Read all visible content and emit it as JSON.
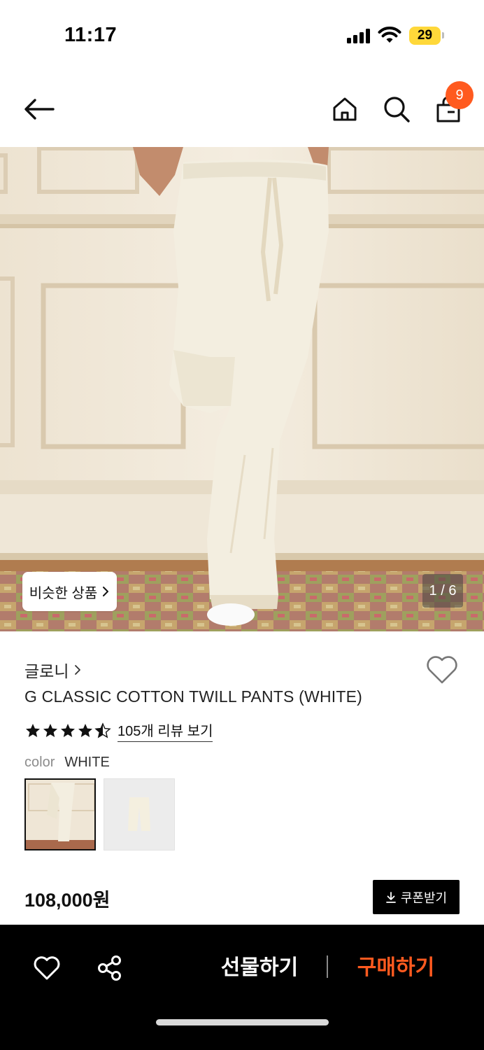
{
  "status_bar": {
    "time": "11:17",
    "battery": "29"
  },
  "nav": {
    "cart_count": "9"
  },
  "hero": {
    "similar_button": "비슷한 상품",
    "page_indicator": "1 / 6"
  },
  "product": {
    "brand": "글로니",
    "title": "G CLASSIC COTTON TWILL PANTS (WHITE)",
    "rating": 4.5,
    "review_link": "105개 리뷰 보기",
    "color_label": "color",
    "color_value": "WHITE",
    "price": "108,000원"
  },
  "coupon_button": "쿠폰받기",
  "bottom_bar": {
    "gift_label": "선물하기",
    "buy_label": "구매하기"
  },
  "colors": {
    "accent": "#ff5a1f",
    "battery": "#ffd83a",
    "bar": "#000000"
  },
  "icons": [
    "back-arrow-icon",
    "home-icon",
    "search-icon",
    "shopping-bag-icon",
    "heart-icon",
    "star-icon",
    "download-icon",
    "share-icon",
    "chevron-right-icon"
  ]
}
